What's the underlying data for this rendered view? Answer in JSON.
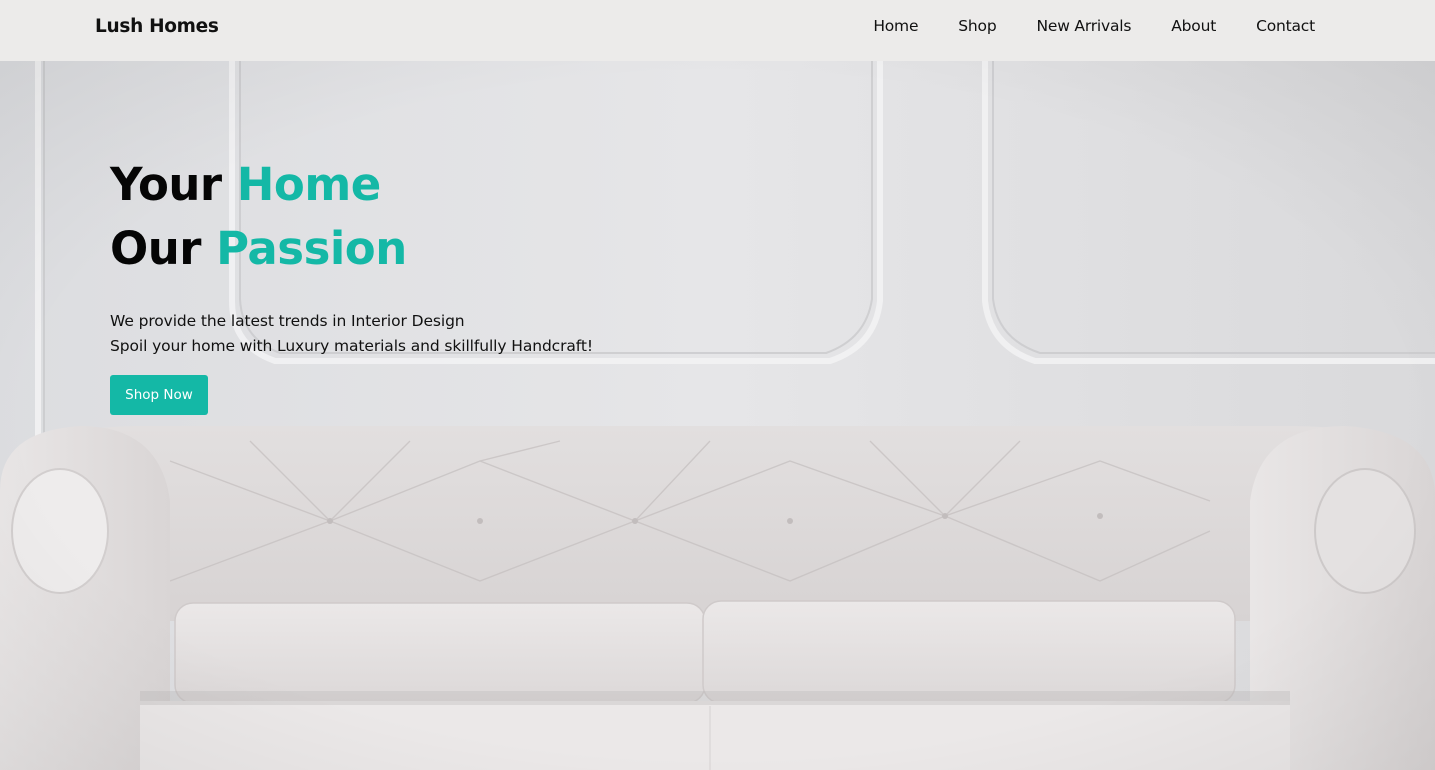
{
  "brand": {
    "name": "Lush Homes"
  },
  "nav": {
    "links": [
      "Home",
      "Shop",
      "New Arrivals",
      "About",
      "Contact"
    ]
  },
  "hero": {
    "line1": {
      "prefix": "Your ",
      "accent": "Home"
    },
    "line2": {
      "prefix": "Our ",
      "accent": "Passion"
    },
    "tagline_line1": "We provide the latest trends in Interior Design",
    "tagline_line2": "Spoil your home with Luxury materials and skillfully Handcraft!",
    "cta_label": "Shop Now",
    "background_image": "white-tufted-chesterfield-sofa"
  },
  "colors": {
    "accent": "#14b8a6",
    "navbar_bg": "#ecebea",
    "hero_bg": "#e3e3e5",
    "text": "#111111"
  }
}
